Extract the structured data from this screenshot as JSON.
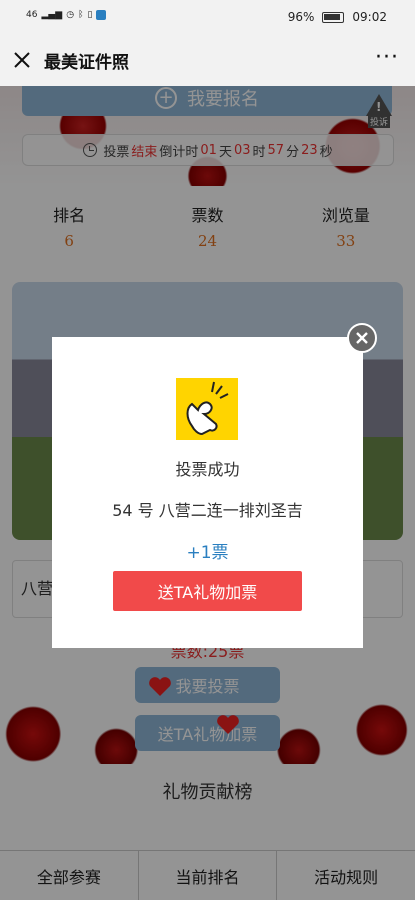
{
  "status_bar": {
    "network": "46",
    "battery": "96%",
    "time": "09:02"
  },
  "header": {
    "title": "最美证件照"
  },
  "page": {
    "register_label": "我要报名",
    "report_label": "投诉",
    "countdown": {
      "prefix": "投票",
      "state": "结束",
      "label": "倒计时",
      "days": "01",
      "days_unit": "天",
      "hours": "03",
      "hours_unit": "时",
      "minutes": "57",
      "minutes_unit": "分",
      "seconds": "23",
      "seconds_unit": "秒"
    },
    "stats": [
      {
        "label": "排名",
        "value": "6"
      },
      {
        "label": "票数",
        "value": "24"
      },
      {
        "label": "浏览量",
        "value": "33"
      }
    ],
    "name_card_text": "八营",
    "vote_count": "票数:25票",
    "vote_button": "我要投票",
    "gift_button": "送TA礼物加票",
    "gift_board_title": "礼物贡献榜"
  },
  "tabs": [
    "全部参赛",
    "当前排名",
    "活动规则"
  ],
  "modal": {
    "title": "投票成功",
    "candidate": "54 号 八营二连一排刘圣吉",
    "plus_votes": "+1票",
    "gift_button": "送TA礼物加票"
  },
  "colors": {
    "accent_red": "#f14a4a",
    "accent_blue": "#2a7fc0",
    "button_blue": "#8fb7d8"
  }
}
